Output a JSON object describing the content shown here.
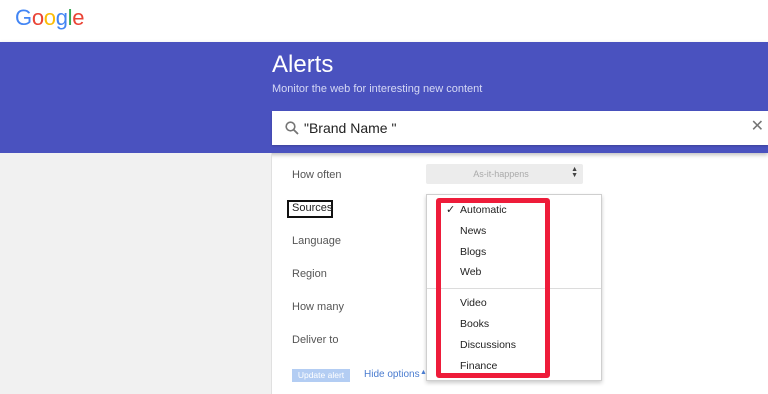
{
  "logo": {
    "letters": [
      "G",
      "o",
      "o",
      "g",
      "l",
      "e"
    ],
    "colors": [
      "#4285F4",
      "#EA4335",
      "#FBBC05",
      "#4285F4",
      "#34A853",
      "#EA4335"
    ]
  },
  "header": {
    "title": "Alerts",
    "subtitle": "Monitor the web for interesting new content",
    "bg_color": "#4a52bf"
  },
  "search": {
    "value": "\"Brand Name \"",
    "icon": "search-icon",
    "clear_icon": "close-icon"
  },
  "options": {
    "how_often_label": "How often",
    "how_often_value": "As-it-happens",
    "sources_label": "Sources",
    "language_label": "Language",
    "region_label": "Region",
    "how_many_label": "How many",
    "deliver_to_label": "Deliver to"
  },
  "sources_dropdown": {
    "selected": "Automatic",
    "items_group1": [
      "Automatic",
      "News",
      "Blogs",
      "Web"
    ],
    "items_group2": [
      "Video",
      "Books",
      "Discussions",
      "Finance"
    ],
    "highlight_color": "#ee1c3a"
  },
  "footer": {
    "update_label": "Update alert",
    "hide_options_label": "Hide options"
  }
}
